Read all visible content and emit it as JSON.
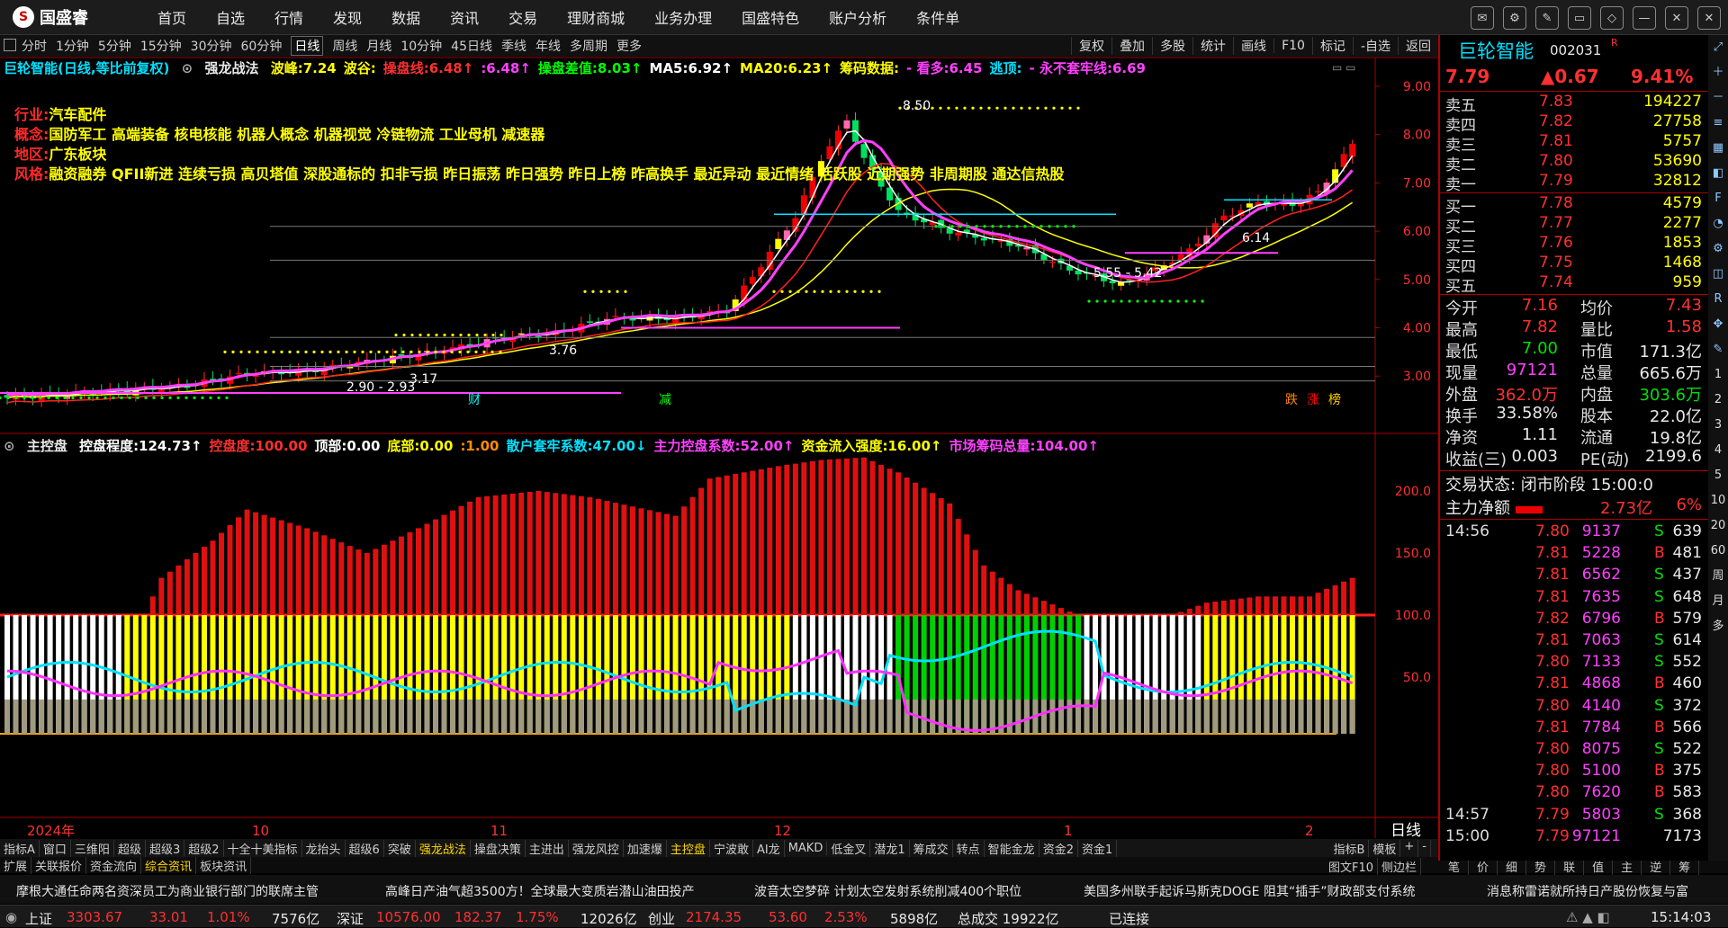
{
  "app": {
    "name": "国盛睿",
    "menu": [
      "首页",
      "自选",
      "行情",
      "发现",
      "数据",
      "资讯",
      "交易",
      "理财商城",
      "业务办理",
      "国盛特色",
      "账户分析",
      "条件单"
    ]
  },
  "periods": {
    "items": [
      "分时",
      "1分钟",
      "5分钟",
      "15分钟",
      "30分钟",
      "60分钟",
      "日线",
      "周线",
      "月线",
      "10分钟",
      "45日线",
      "季线",
      "年线",
      "多周期",
      "更多"
    ],
    "active": "日线"
  },
  "chart_tools": [
    "复权",
    "叠加",
    "多股",
    "统计",
    "画线",
    "F10",
    "标记",
    "-自选",
    "返回"
  ],
  "main_header": {
    "title": "巨轮智能(日线,等比前复权)",
    "indicator": "强龙战法",
    "items": [
      {
        "label": "波峰:7.24",
        "color": "#ffff00"
      },
      {
        "label": "波谷:",
        "color": "#ffff00"
      },
      {
        "label": "操盘线:6.48↑",
        "color": "#ff3030"
      },
      {
        "label": ":6.48↑",
        "color": "#ff40ff"
      },
      {
        "label": "操盘差值:8.03↑",
        "color": "#00ff00"
      },
      {
        "label": "MA5:6.92↑",
        "color": "#ffffff"
      },
      {
        "label": "MA20:6.23↑",
        "color": "#ffff00"
      },
      {
        "label": "筹码数据:",
        "color": "#ffff00"
      },
      {
        "label": "- 看多:6.45",
        "color": "#ff40ff"
      },
      {
        "label": "逃顶:",
        "color": "#00e0ff"
      },
      {
        "label": "- 永不套牢线:6.69",
        "color": "#ff40ff"
      }
    ]
  },
  "info": [
    {
      "key": "行业:",
      "value": "汽车配件"
    },
    {
      "key": "概念:",
      "value": "国防军工 高端装备 核电核能 机器人概念 机器视觉 冷链物流 工业母机 减速器"
    },
    {
      "key": "地区:",
      "value": "广东板块"
    },
    {
      "key": "风格:",
      "value": "融资融券 QFII新进 连续亏损 高贝塔值 深股通标的 扣非亏损 昨日振荡 昨日强势 昨日上榜 昨高换手 最近异动 最近情绪 活跃股 近期强势 非周期股 通达信热股"
    }
  ],
  "price_axis": [
    "9.00",
    "8.00",
    "7.00",
    "6.00",
    "5.00",
    "4.00",
    "3.00"
  ],
  "chart_marks": [
    "8.50",
    "5.55 - 5.42",
    "6.14",
    "2.90 - 2.93",
    "3.17",
    "3.76",
    "财",
    "减",
    "跌",
    "涨",
    "榜"
  ],
  "sub_header": {
    "name": "主控盘",
    "items": [
      {
        "label": "控盘程度:124.73↑",
        "color": "#ffffff"
      },
      {
        "label": "控盘度:100.00",
        "color": "#ff3030"
      },
      {
        "label": "顶部:0.00",
        "color": "#ffffff"
      },
      {
        "label": "底部:0.00",
        "color": "#ffff00"
      },
      {
        "label": ":1.00",
        "color": "#ff8c00"
      },
      {
        "label": "散户套牢系数:47.00↓",
        "color": "#00e0ff"
      },
      {
        "label": "主力控盘系数:52.00↑",
        "color": "#ff40ff"
      },
      {
        "label": "资金流入强度:16.00↑",
        "color": "#ffff00"
      },
      {
        "label": "市场筹码总量:104.00↑",
        "color": "#ff40ff"
      }
    ]
  },
  "sub_axis": [
    "200.0",
    "150.0",
    "100.0",
    "50.0"
  ],
  "date_axis": [
    "2024年",
    "10",
    "11",
    "12",
    "1",
    "2"
  ],
  "period_label": "日线",
  "indicator_tabs": [
    "指标A",
    "窗口",
    "三维阳",
    "超级",
    "超级3",
    "超级2",
    "十全十美指标",
    "龙抬头",
    "超级6",
    "突破",
    "强龙战法",
    "操盘决策",
    "主进出",
    "强龙风控",
    "加速爆",
    "主控盘",
    "宁波敢",
    "AI龙",
    "MAKD",
    "低金叉",
    "潜龙1",
    "筹成交",
    "转点",
    "智能金龙",
    "资金2",
    "资金1"
  ],
  "indicator_tabs_active": [
    "强龙战法",
    "主控盘"
  ],
  "indicator_tabs_right": [
    "指标B",
    "模板",
    "+",
    "-"
  ],
  "bottom_tabs": [
    "扩展",
    "关联报价",
    "资金流向",
    "综合资讯",
    "板块资讯"
  ],
  "bottom_tabs_active": "综合资讯",
  "bottom_tabs_right": [
    "图文F10",
    "侧边栏"
  ],
  "news": [
    "摩根大通任命两名资深员工为商业银行部门的联席主管",
    "高峰日产油气超3500方！全球最大变质岩潜山油田投产",
    "波音太空梦碎 计划太空发射系统削减400个职位",
    "美国多州联手起诉马斯克DOGE 阻其“插手”财政部支付系统",
    "消息称雷诺就所持日产股份恢复与富"
  ],
  "status": {
    "sh": {
      "name": "上证",
      "price": "3303.67",
      "chg": "33.01",
      "pct": "1.01%",
      "amt": "7576亿"
    },
    "sz": {
      "name": "深证",
      "price": "10576.00",
      "chg": "182.37",
      "pct": "1.75%",
      "amt": "12026亿"
    },
    "cy": {
      "name": "创业",
      "price": "2174.35",
      "chg": "53.60",
      "pct": "2.53%",
      "amt": "5898亿"
    },
    "total": "总成交 19922亿",
    "conn": "已连接",
    "time": "15:14:03"
  },
  "stock": {
    "name": "巨轮智能",
    "code": "002031",
    "flag": "R",
    "price": "7.79",
    "change": "▲0.67",
    "pct": "9.41%"
  },
  "asks": [
    {
      "label": "卖五",
      "price": "7.83",
      "vol": "194227"
    },
    {
      "label": "卖四",
      "price": "7.82",
      "vol": "27758"
    },
    {
      "label": "卖三",
      "price": "7.81",
      "vol": "5757"
    },
    {
      "label": "卖二",
      "price": "7.80",
      "vol": "53690"
    },
    {
      "label": "卖一",
      "price": "7.79",
      "vol": "32812"
    }
  ],
  "bids": [
    {
      "label": "买一",
      "price": "7.78",
      "vol": "4579"
    },
    {
      "label": "买二",
      "price": "7.77",
      "vol": "2277"
    },
    {
      "label": "买三",
      "price": "7.76",
      "vol": "1853"
    },
    {
      "label": "买四",
      "price": "7.75",
      "vol": "1468"
    },
    {
      "label": "买五",
      "price": "7.74",
      "vol": "959"
    }
  ],
  "stats": [
    {
      "l1": "今开",
      "v1": "7.16",
      "c1": "#ff3030",
      "l2": "均价",
      "v2": "7.43",
      "c2": "#ff3030"
    },
    {
      "l1": "最高",
      "v1": "7.82",
      "c1": "#ff3030",
      "l2": "量比",
      "v2": "1.58",
      "c2": "#ff3030"
    },
    {
      "l1": "最低",
      "v1": "7.00",
      "c1": "#00e000",
      "l2": "市值",
      "v2": "171.3亿",
      "c2": "#e8e8e8"
    },
    {
      "l1": "现量",
      "v1": "97121",
      "c1": "#ff40ff",
      "l2": "总量",
      "v2": "665.6万",
      "c2": "#e8e8e8"
    },
    {
      "l1": "外盘",
      "v1": "362.0万",
      "c1": "#ff3030",
      "l2": "内盘",
      "v2": "303.6万",
      "c2": "#00e000"
    },
    {
      "l1": "换手",
      "v1": "33.58%",
      "c1": "#e8e8e8",
      "l2": "股本",
      "v2": "22.0亿",
      "c2": "#e8e8e8"
    },
    {
      "l1": "净资",
      "v1": "1.11",
      "c1": "#e8e8e8",
      "l2": "流通",
      "v2": "19.8亿",
      "c2": "#e8e8e8"
    },
    {
      "l1": "收益(三)",
      "v1": "0.003",
      "c1": "#e8e8e8",
      "l2": "PE(动)",
      "v2": "2199.6",
      "c2": "#e8e8e8"
    }
  ],
  "trade_state": "交易状态: 闭市阶段 15:00:0",
  "main_flow": {
    "label": "主力净额",
    "value": "2.73亿",
    "pct": "6%"
  },
  "ticks": [
    {
      "t": "14:56",
      "p": "7.80",
      "v": "9137",
      "s": "S",
      "n": "639"
    },
    {
      "t": "",
      "p": "7.81",
      "v": "5228",
      "s": "B",
      "n": "481"
    },
    {
      "t": "",
      "p": "7.81",
      "v": "6562",
      "s": "S",
      "n": "437"
    },
    {
      "t": "",
      "p": "7.81",
      "v": "7635",
      "s": "S",
      "n": "648"
    },
    {
      "t": "",
      "p": "7.82",
      "v": "6796",
      "s": "B",
      "n": "579"
    },
    {
      "t": "",
      "p": "7.81",
      "v": "7063",
      "s": "S",
      "n": "614"
    },
    {
      "t": "",
      "p": "7.80",
      "v": "7133",
      "s": "S",
      "n": "552"
    },
    {
      "t": "",
      "p": "7.81",
      "v": "4868",
      "s": "B",
      "n": "460"
    },
    {
      "t": "",
      "p": "7.80",
      "v": "4140",
      "s": "S",
      "n": "372"
    },
    {
      "t": "",
      "p": "7.81",
      "v": "7784",
      "s": "B",
      "n": "566"
    },
    {
      "t": "",
      "p": "7.80",
      "v": "8075",
      "s": "S",
      "n": "522"
    },
    {
      "t": "",
      "p": "7.80",
      "v": "5100",
      "s": "B",
      "n": "375"
    },
    {
      "t": "",
      "p": "7.80",
      "v": "7620",
      "s": "B",
      "n": "583"
    },
    {
      "t": "14:57",
      "p": "7.79",
      "v": "5803",
      "s": "S",
      "n": "368"
    },
    {
      "t": "15:00",
      "p": "7.79",
      "v": "97121",
      "s": "",
      "n": "7173"
    }
  ],
  "rp_tabs": [
    "笔",
    "价",
    "细",
    "势",
    "联",
    "值",
    "主",
    "逆",
    "筹"
  ],
  "sidebar_icons": [
    "expand-icon",
    "zoom-in-icon",
    "zoom-out-icon",
    "list-icon",
    "grid-icon",
    "chart-icon",
    "f10-icon",
    "chart-icon",
    "settings-icon",
    "chart-icon",
    "rsi-icon",
    "move-icon",
    "pen-icon"
  ],
  "sidebar_labels": [
    "1",
    "2",
    "3",
    "4",
    "5",
    "10",
    "20",
    "60",
    "周",
    "月",
    "多"
  ]
}
